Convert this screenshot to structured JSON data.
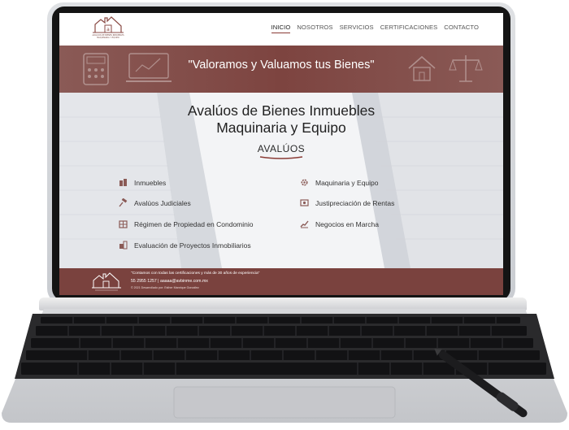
{
  "header": {
    "logo_text": "AVALUOS DE BIENES INMUEBLES MAQUINARIA Y EQUIPO",
    "nav": [
      {
        "label": "INICIO",
        "active": true
      },
      {
        "label": "NOSOTROS",
        "active": false
      },
      {
        "label": "SERVICIOS",
        "active": false
      },
      {
        "label": "CERTIFICACIONES",
        "active": false
      },
      {
        "label": "CONTACTO",
        "active": false
      }
    ]
  },
  "banner": {
    "quote": "\"Valoramos y Valuamos tus Bienes\""
  },
  "main": {
    "title_line1": "Avalúos de Bienes Inmuebles",
    "title_line2": "Maquinaria y Equipo",
    "subtitle": "AVALÚOS",
    "services_left": [
      {
        "label": "Inmuebles",
        "icon": "buildings-icon"
      },
      {
        "label": "Avalúos Judiciales",
        "icon": "gavel-icon"
      },
      {
        "label": "Régimen de Propiedad en Condominio",
        "icon": "condo-icon"
      },
      {
        "label": "Evaluación de Proyectos Inmobiliarios",
        "icon": "project-icon"
      }
    ],
    "services_right": [
      {
        "label": "Maquinaria y Equipo",
        "icon": "gear-icon"
      },
      {
        "label": "Justipreciación de Rentas",
        "icon": "money-icon"
      },
      {
        "label": "Negocios en Marcha",
        "icon": "chart-icon"
      }
    ]
  },
  "footer": {
    "quote": "\"Contamos con todas las certificaciones y más de 30 años de experiencia\"",
    "contact": "55 2955 1257 | aaaaa@avbinme.com.mx",
    "copyright": "© 2021 Desarrollado por: Esther Manrique González"
  },
  "colors": {
    "brand": "#7a423e",
    "accent": "#8a3b35"
  }
}
